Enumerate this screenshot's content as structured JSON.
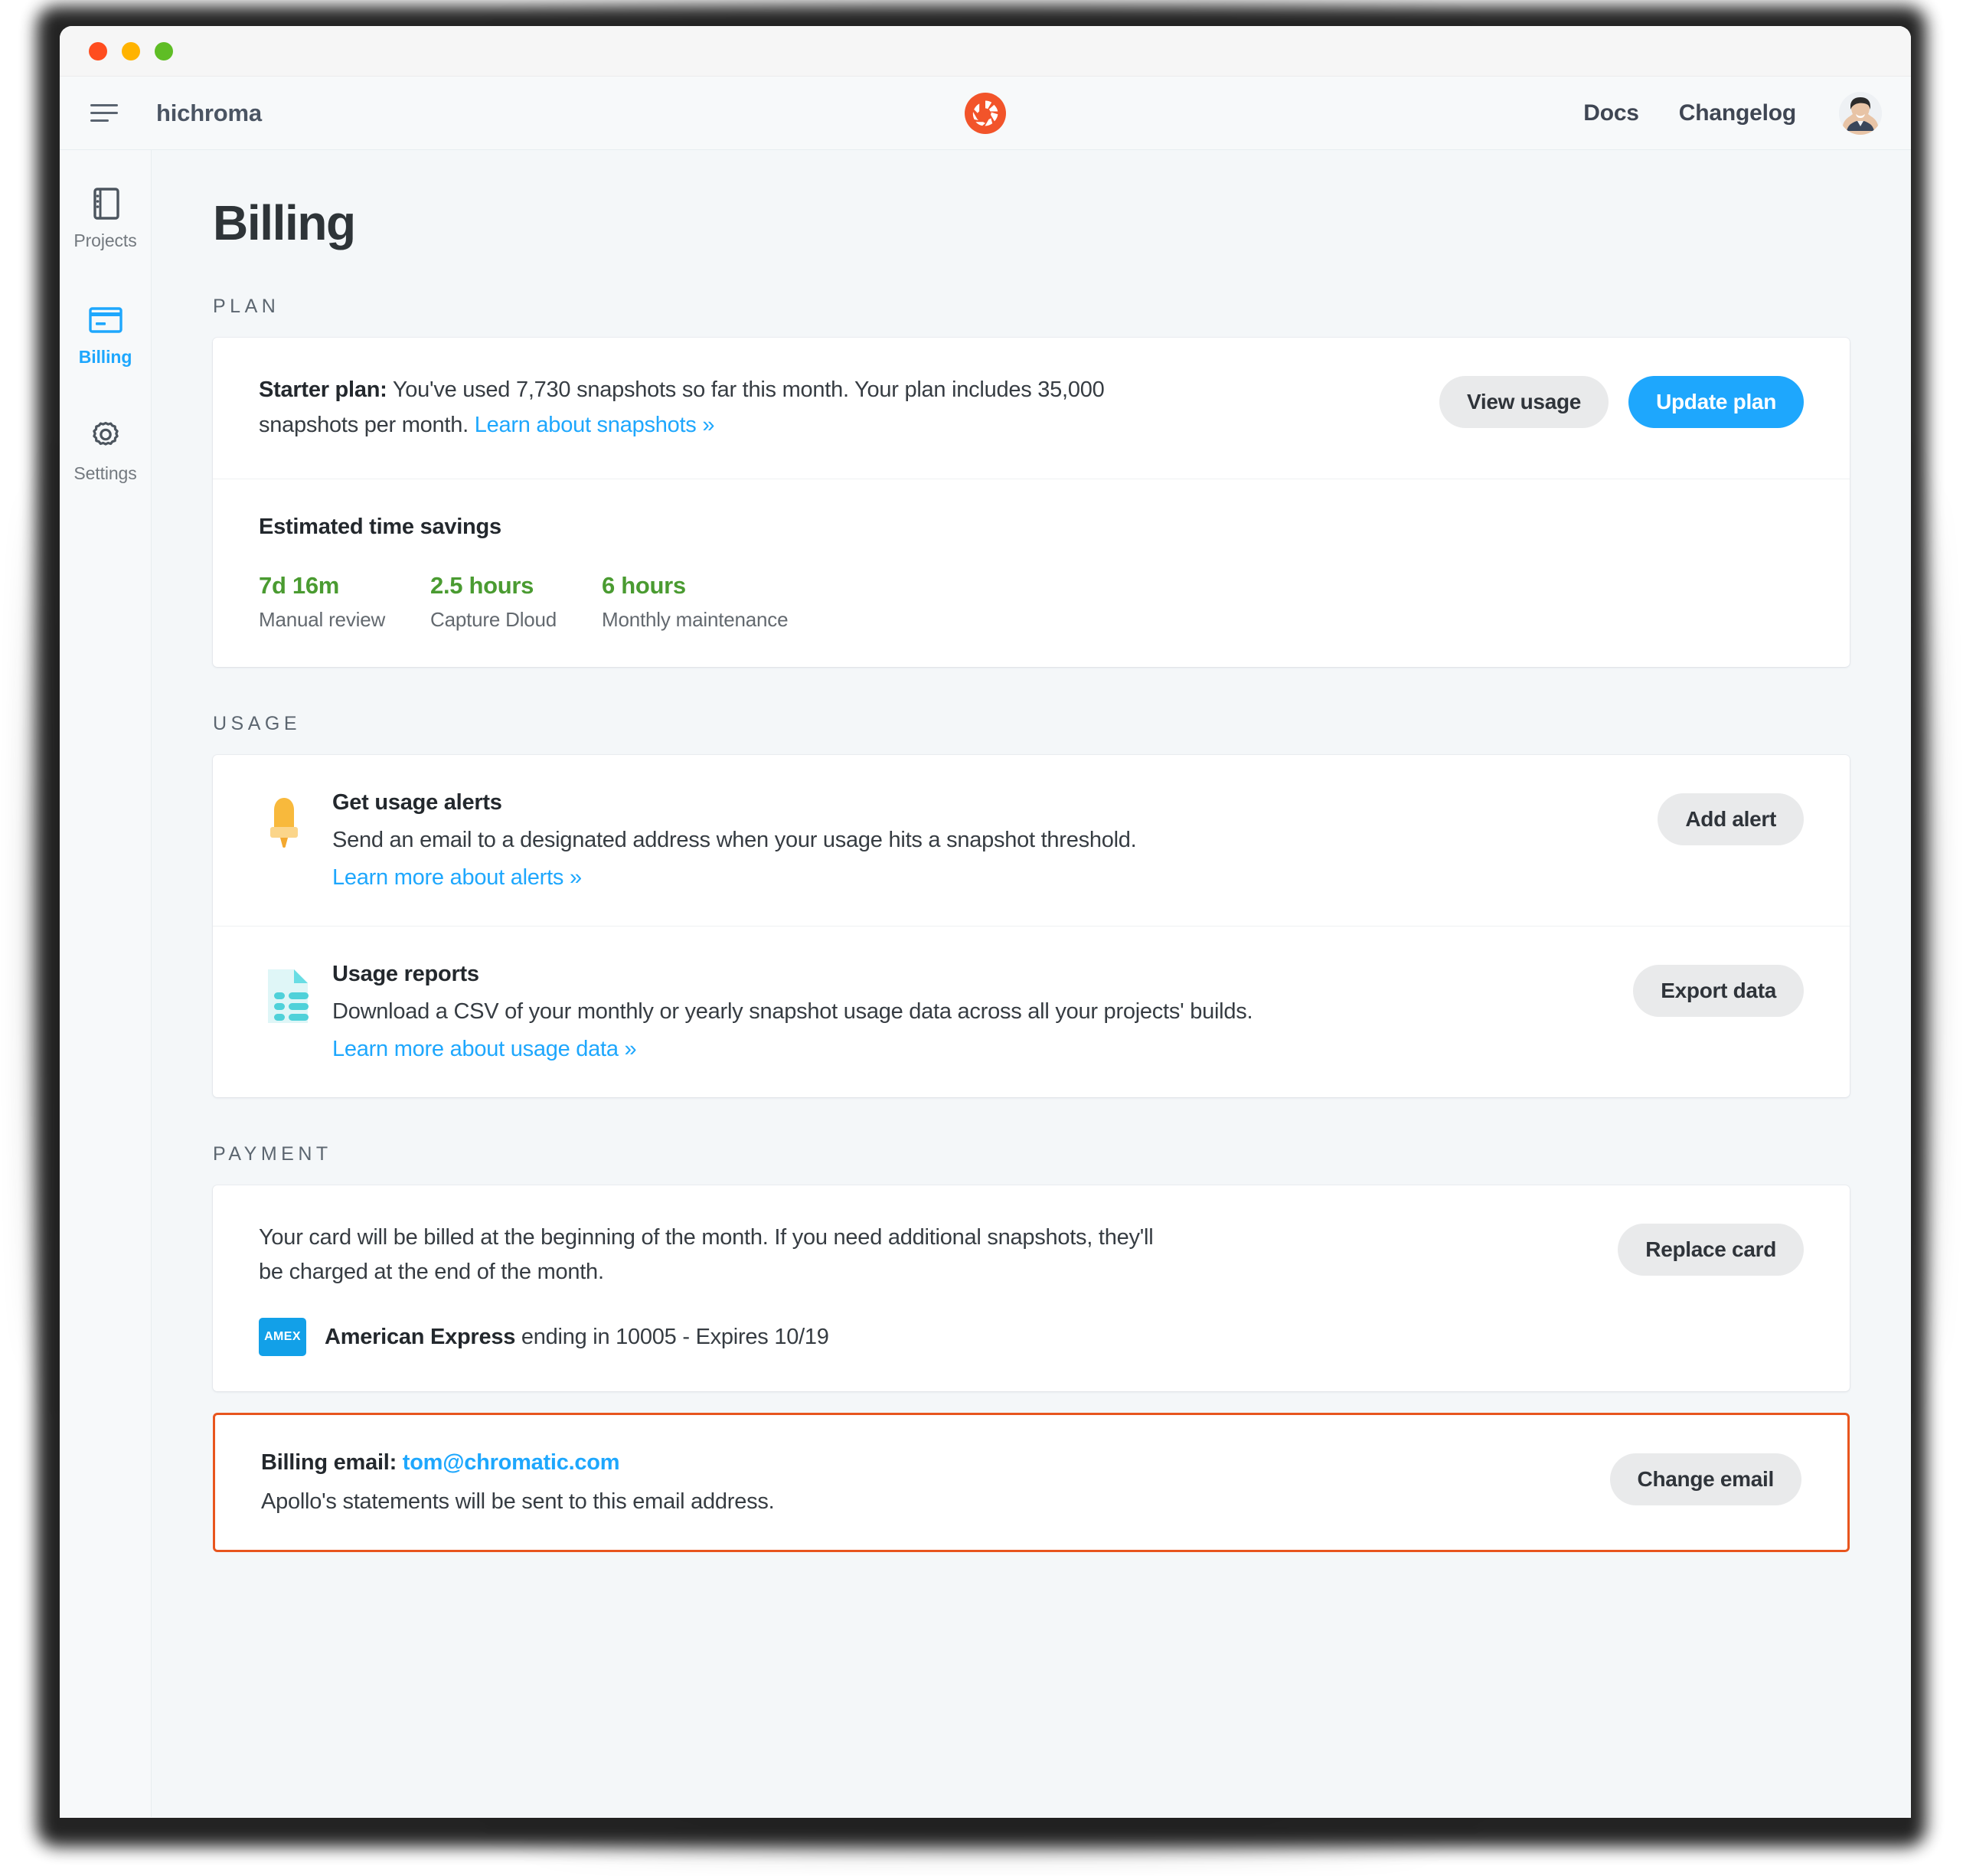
{
  "window": {
    "traffic_lights": [
      "close",
      "minimize",
      "maximize"
    ]
  },
  "header": {
    "menu_icon": "hamburger-icon",
    "org_name": "hichroma",
    "logo": "chromatic-logo",
    "links": [
      {
        "label": "Docs"
      },
      {
        "label": "Changelog"
      }
    ],
    "avatar": "user-avatar"
  },
  "sidebar": {
    "items": [
      {
        "label": "Projects",
        "icon": "notebook-icon",
        "active": false
      },
      {
        "label": "Billing",
        "icon": "credit-card-icon",
        "active": true
      },
      {
        "label": "Settings",
        "icon": "gear-icon",
        "active": false
      }
    ]
  },
  "main": {
    "page_title": "Billing",
    "sections": {
      "plan": {
        "label": "PLAN",
        "plan_name": "Starter plan:",
        "plan_description": " You've used 7,730 snapshots so far this month. Your plan includes 35,000 snapshots per month. ",
        "plan_link": "Learn about snapshots »",
        "view_usage_label": "View usage",
        "update_plan_label": "Update plan",
        "savings": {
          "title": "Estimated time savings",
          "items": [
            {
              "value": "7d 16m",
              "label": "Manual review"
            },
            {
              "value": "2.5 hours",
              "label": "Capture Dloud"
            },
            {
              "value": "6 hours",
              "label": "Monthly maintenance"
            }
          ]
        }
      },
      "usage": {
        "label": "USAGE",
        "alerts": {
          "icon": "bell-icon",
          "title": "Get usage alerts",
          "description": "Send an email to a designated address when your usage hits a snapshot threshold.",
          "link": "Learn more about alerts »",
          "button": "Add alert"
        },
        "reports": {
          "icon": "document-list-icon",
          "title": "Usage reports",
          "description": "Download a CSV of your monthly or yearly snapshot usage data across all your projects' builds.",
          "link": "Learn more about usage data »",
          "button": "Export data"
        }
      },
      "payment": {
        "label": "PAYMENT",
        "billing_note": "Your card will be billed at the beginning of the month. If you need additional snapshots, they'll be charged at the end of the month.",
        "card_brand_badge": "AMEX",
        "card_brand": "American Express",
        "card_detail": " ending in 10005 - Expires 10/19",
        "replace_card_label": "Replace card",
        "email": {
          "label": "Billing email:",
          "address": "tom@chromatic.com",
          "note": "Apollo's statements will be sent to this email address.",
          "button": "Change email"
        }
      }
    }
  },
  "colors": {
    "accent_blue": "#1ea7fd",
    "brand_orange": "#e8551e",
    "savings_green": "#4a9b31",
    "highlight_border": "#e8551e",
    "amex_blue": "#12a0e8",
    "bell_yellow": "#f5b93d",
    "doc_teal": "#4fd1d9"
  }
}
